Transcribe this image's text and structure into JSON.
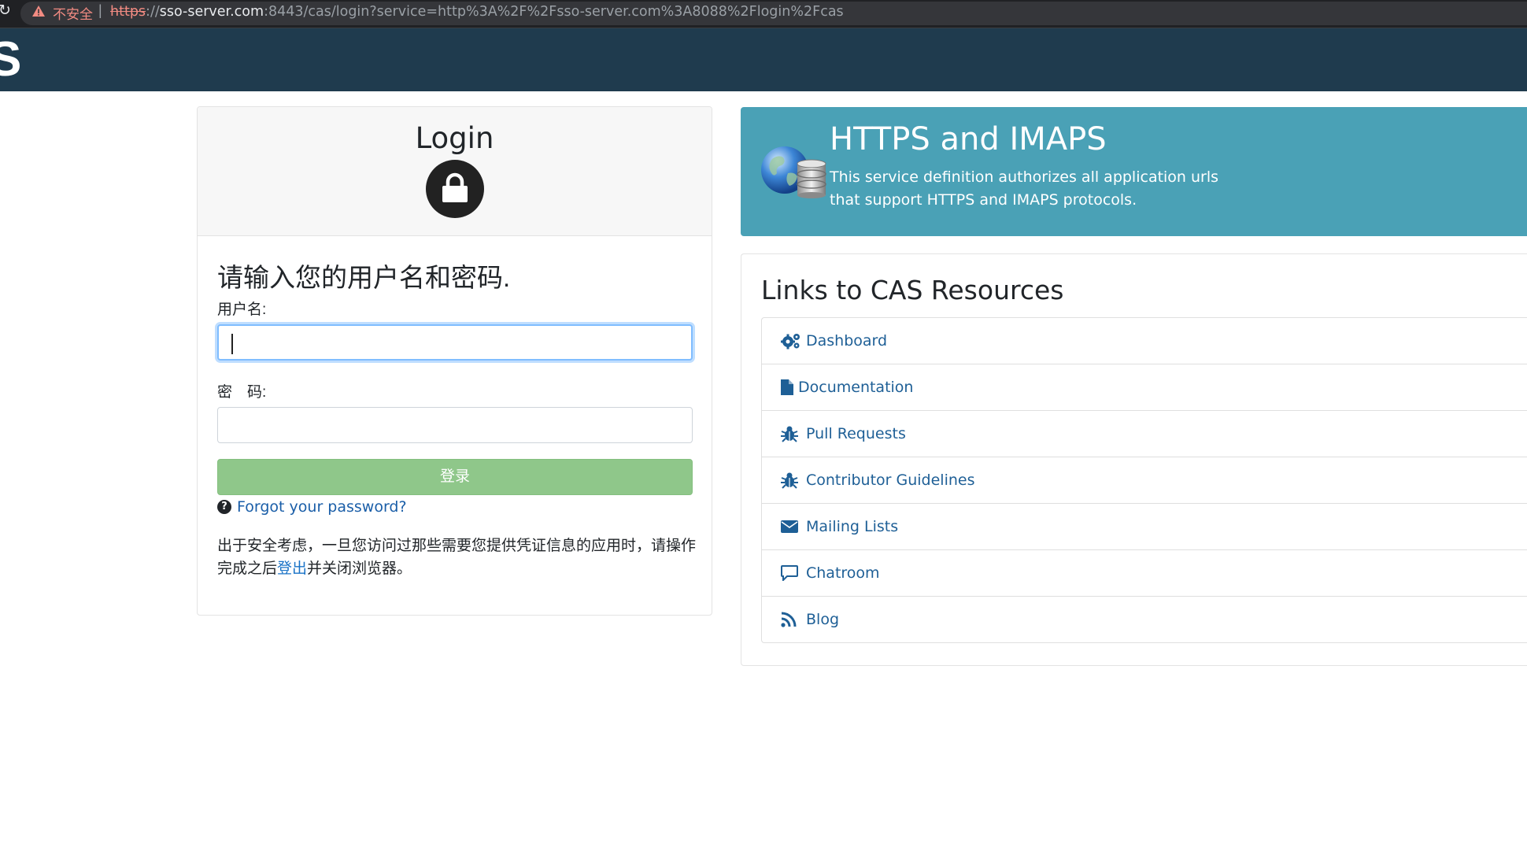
{
  "browser": {
    "security_label": "不安全",
    "separator": "|",
    "url_scheme": "https",
    "url_sep": "://",
    "url_host": "sso-server.com",
    "url_rest": ":8443/cas/login?service=http%3A%2F%2Fsso-server.com%3A8088%2Flogin%2Fcas",
    "reload_icon": "reload-icon",
    "warning_icon": "warning-triangle-icon"
  },
  "header": {
    "logo_text": "S"
  },
  "login": {
    "title": "Login",
    "lock_icon": "lock-icon",
    "prompt": "请输入您的用户名和密码.",
    "username_label": "用户名:",
    "username_value": "",
    "password_label": "密　码:",
    "password_value": "",
    "submit_label": "登录",
    "forgot_label": "Forgot your password?",
    "notice_before": "出于安全考虑，一旦您访问过那些需要您提供凭证信息的应用时，请操作完成之后",
    "notice_link": "登出",
    "notice_after": "并关闭浏览器。"
  },
  "service": {
    "title": "HTTPS and IMAPS",
    "description": "This service definition authorizes all application urls that support HTTPS and IMAPS protocols.",
    "icon": "globe-database-icon"
  },
  "resources": {
    "title": "Links to CAS Resources",
    "items": [
      {
        "label": "Dashboard",
        "icon": "gears-icon"
      },
      {
        "label": "Documentation",
        "icon": "file-icon"
      },
      {
        "label": "Pull Requests",
        "icon": "bug-icon"
      },
      {
        "label": "Contributor Guidelines",
        "icon": "bug-icon"
      },
      {
        "label": "Mailing Lists",
        "icon": "envelope-icon"
      },
      {
        "label": "Chatroom",
        "icon": "chat-bubble-icon"
      },
      {
        "label": "Blog",
        "icon": "rss-icon"
      }
    ]
  },
  "colors": {
    "header_bg": "#1f3b4e",
    "banner_bg": "#4aa1b6",
    "submit_bg": "#8fc78a",
    "link": "#1e5f96"
  }
}
